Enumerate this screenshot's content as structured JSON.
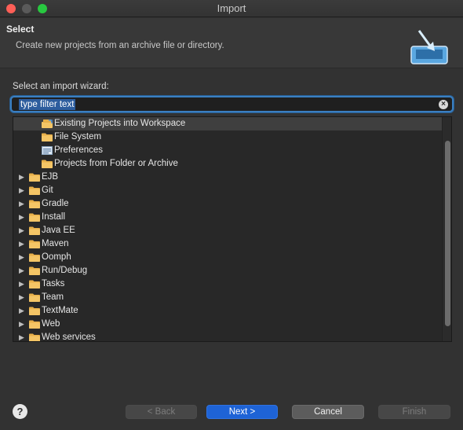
{
  "window": {
    "title": "Import"
  },
  "header": {
    "title": "Select",
    "description": "Create new projects from an archive file or directory."
  },
  "wizard_label": "Select an import wizard:",
  "filter": {
    "value": "type filter text"
  },
  "tree": {
    "items": [
      {
        "label": "Existing Projects into Workspace",
        "level": 1,
        "expandable": false,
        "icon": "import-projects-icon",
        "selected": true
      },
      {
        "label": "File System",
        "level": 1,
        "expandable": false,
        "icon": "folder-icon"
      },
      {
        "label": "Preferences",
        "level": 1,
        "expandable": false,
        "icon": "preferences-icon"
      },
      {
        "label": "Projects from Folder or Archive",
        "level": 1,
        "expandable": false,
        "icon": "folder-icon"
      },
      {
        "label": "EJB",
        "level": 0,
        "expandable": true,
        "icon": "folder-icon"
      },
      {
        "label": "Git",
        "level": 0,
        "expandable": true,
        "icon": "folder-icon"
      },
      {
        "label": "Gradle",
        "level": 0,
        "expandable": true,
        "icon": "folder-icon"
      },
      {
        "label": "Install",
        "level": 0,
        "expandable": true,
        "icon": "folder-icon"
      },
      {
        "label": "Java EE",
        "level": 0,
        "expandable": true,
        "icon": "folder-icon"
      },
      {
        "label": "Maven",
        "level": 0,
        "expandable": true,
        "icon": "folder-icon"
      },
      {
        "label": "Oomph",
        "level": 0,
        "expandable": true,
        "icon": "folder-icon"
      },
      {
        "label": "Run/Debug",
        "level": 0,
        "expandable": true,
        "icon": "folder-icon"
      },
      {
        "label": "Tasks",
        "level": 0,
        "expandable": true,
        "icon": "folder-icon"
      },
      {
        "label": "Team",
        "level": 0,
        "expandable": true,
        "icon": "folder-icon"
      },
      {
        "label": "TextMate",
        "level": 0,
        "expandable": true,
        "icon": "folder-icon"
      },
      {
        "label": "Web",
        "level": 0,
        "expandable": true,
        "icon": "folder-icon"
      },
      {
        "label": "Web services",
        "level": 0,
        "expandable": true,
        "icon": "folder-icon"
      }
    ]
  },
  "buttons": {
    "help": "?",
    "back": "< Back",
    "next": "Next >",
    "cancel": "Cancel",
    "finish": "Finish"
  },
  "colors": {
    "accent": "#1e63d6",
    "focus_ring": "#3a7fc1",
    "folder": "#e8b04a"
  }
}
